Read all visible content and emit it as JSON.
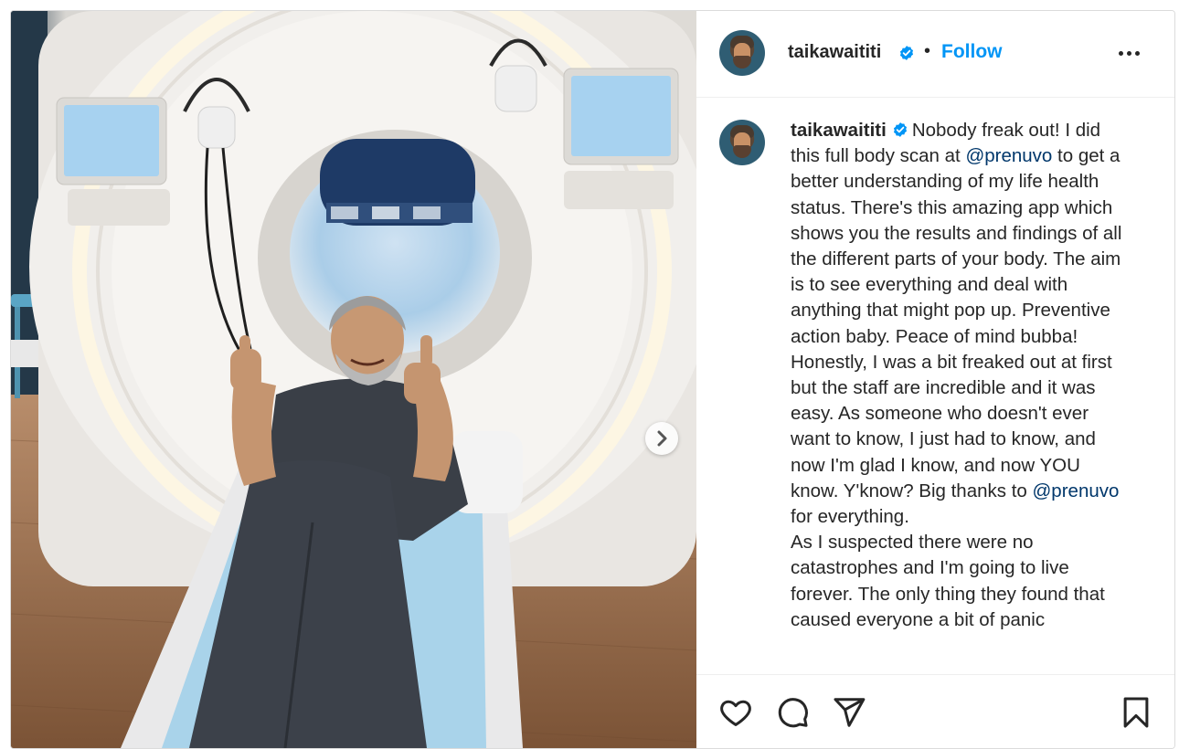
{
  "post": {
    "author": {
      "username": "taikawaititi",
      "verified": true,
      "avatar": "profile-photo"
    },
    "header": {
      "separator": "•",
      "follow_label": "Follow"
    },
    "caption": {
      "username": "taikawaititi",
      "segments": [
        {
          "type": "text",
          "text": "Nobody freak out! I did this full body scan at "
        },
        {
          "type": "mention",
          "text": "@prenuvo"
        },
        {
          "type": "text",
          "text": " to get a better understanding of my life health status. There's this amazing app which shows you the results and findings of all the different parts of your body. The aim is to see everything and deal with anything that might pop up. Preventive action baby. Peace of mind bubba!\nHonestly, I was a bit freaked out at first but the staff are incredible and it was easy. As someone who doesn't ever want to know, I just had to know, and now I'm glad I know, and now YOU know. Y'know? Big thanks to "
        },
        {
          "type": "mention",
          "text": "@prenuvo"
        },
        {
          "type": "text",
          "text": " for everything.\nAs I suspected there were no catastrophes and I'm going to live forever. The only thing they found that caused everyone a bit of panic"
        }
      ]
    },
    "media": {
      "description_icon": "mri-scanner-photo",
      "next_icon": "chevron-right-icon"
    },
    "actions": {
      "like_icon": "heart-icon",
      "comment_icon": "comment-icon",
      "share_icon": "share-icon",
      "save_icon": "bookmark-icon"
    },
    "colors": {
      "follow_blue": "#0095f6",
      "mention_blue": "#00376b",
      "verified_blue": "#0095f6",
      "text": "#262626"
    }
  }
}
